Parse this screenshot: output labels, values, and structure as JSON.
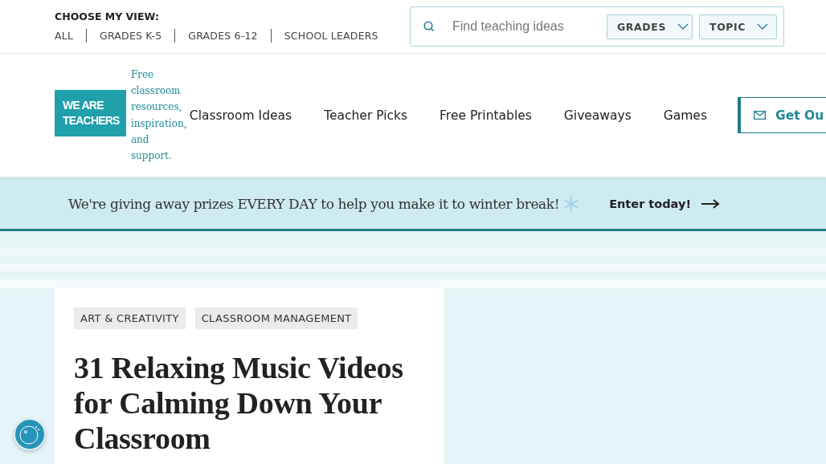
{
  "view_chooser": {
    "label": "CHOOSE MY VIEW:",
    "options": [
      {
        "label": "ALL"
      },
      {
        "label": "GRADES K-5"
      },
      {
        "label": "GRADES 6-12"
      },
      {
        "label": "SCHOOL LEADERS"
      }
    ]
  },
  "search": {
    "placeholder": "Find teaching ideas",
    "filters": [
      {
        "label": "GRADES"
      },
      {
        "label": "TOPIC"
      }
    ]
  },
  "logo": {
    "lines": [
      "WE ARE",
      "TEACHERS"
    ],
    "tagline": "Free classroom resources, inspiration, and support."
  },
  "nav": {
    "items": [
      {
        "label": "Classroom Ideas"
      },
      {
        "label": "Teacher Picks"
      },
      {
        "label": "Free Printables"
      },
      {
        "label": "Giveaways"
      },
      {
        "label": "Games"
      }
    ],
    "cta": "Get Ou"
  },
  "banner": {
    "text": "We're giving away prizes EVERY DAY to help you make it to winter break!",
    "link": "Enter today!"
  },
  "article": {
    "tags": [
      {
        "label": "ART & CREATIVITY"
      },
      {
        "label": "CLASSROOM MANAGEMENT"
      }
    ],
    "title": "31 Relaxing Music Videos for Calming Down Your Classroom"
  }
}
